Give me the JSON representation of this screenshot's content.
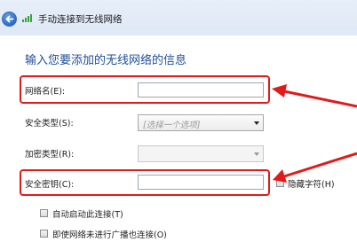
{
  "window": {
    "title": "手动连接到无线网络",
    "back_icon": "back-arrow-icon",
    "network_icon": "wireless-signal-icon"
  },
  "heading": "输入您要添加的无线网络的信息",
  "form": {
    "network_name": {
      "label": "网络名(E):",
      "value": ""
    },
    "security_type": {
      "label": "安全类型(S):",
      "selected": "[选择一个选项]"
    },
    "encryption_type": {
      "label": "加密类型(R):",
      "selected": ""
    },
    "security_key": {
      "label": "安全密钥(C):",
      "value": ""
    },
    "hide_characters": {
      "label": "隐藏字符(H)",
      "checked": false
    },
    "auto_start": {
      "label": "自动启动此连接(T)",
      "checked": false
    },
    "connect_if_not_broadcasting": {
      "label": "即使网络未进行广播也连接(O)",
      "checked": false
    }
  },
  "colors": {
    "heading": "#1f4e9a",
    "annotation": "#e21a1a",
    "titlebar": "#dfe9f6"
  }
}
